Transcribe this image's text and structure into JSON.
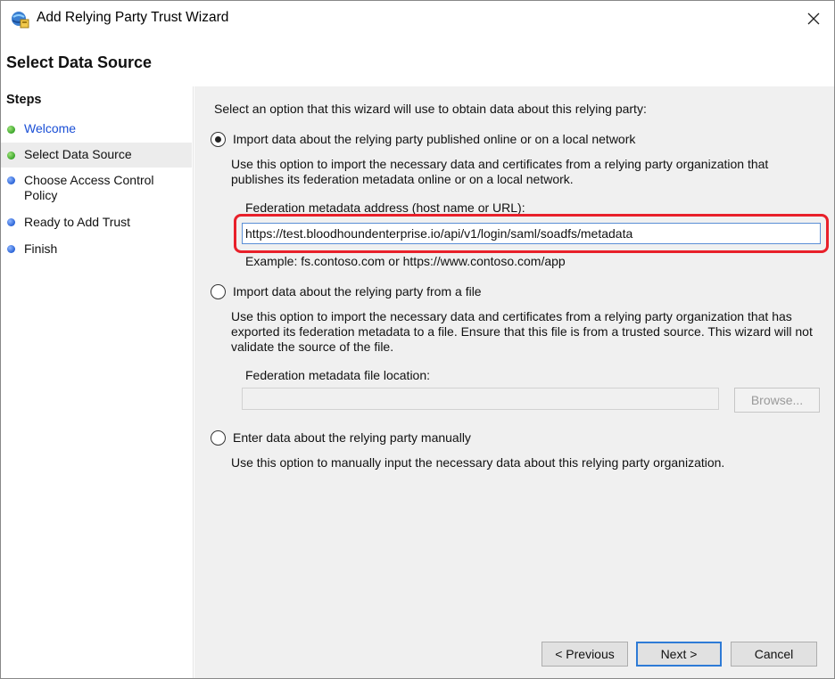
{
  "window": {
    "title": "Add Relying Party Trust Wizard",
    "close_glyph": "✕"
  },
  "header": {
    "page_title": "Select Data Source"
  },
  "steps": {
    "heading": "Steps",
    "items": [
      {
        "label": "Welcome",
        "status": "complete",
        "is_link": true
      },
      {
        "label": "Select Data Source",
        "status": "complete",
        "is_current": true
      },
      {
        "label": "Choose Access Control Policy",
        "status": "pending"
      },
      {
        "label": "Ready to Add Trust",
        "status": "pending"
      },
      {
        "label": "Finish",
        "status": "pending"
      }
    ]
  },
  "main": {
    "intro": "Select an option that this wizard will use to obtain data about this relying party:",
    "option_online": {
      "label": "Import data about the relying party published online or on a local network",
      "description": "Use this option to import the necessary data and certificates from a relying party organization that publishes its federation metadata online or on a local network.",
      "field_label": "Federation metadata address (host name or URL):",
      "field_value": "https://test.bloodhoundenterprise.io/api/v1/login/saml/soadfs/metadata",
      "example": "Example: fs.contoso.com or https://www.contoso.com/app",
      "selected": true
    },
    "option_file": {
      "label": "Import data about the relying party from a file",
      "description": "Use this option to import the necessary data and certificates from a relying party organization that has exported its federation metadata to a file. Ensure that this file is from a trusted source.  This wizard will not validate the source of the file.",
      "field_label": "Federation metadata file location:",
      "field_value": "",
      "browse_label": "Browse...",
      "selected": false
    },
    "option_manual": {
      "label": "Enter data about the relying party manually",
      "description": "Use this option to manually input the necessary data about this relying party organization.",
      "selected": false
    }
  },
  "footer": {
    "previous_label": "< Previous",
    "next_label": "Next >",
    "cancel_label": "Cancel"
  },
  "colors": {
    "highlight": "#e8202a",
    "step_complete": "#3aa52a",
    "step_pending": "#2a63d6",
    "link": "#1a4fd6"
  }
}
